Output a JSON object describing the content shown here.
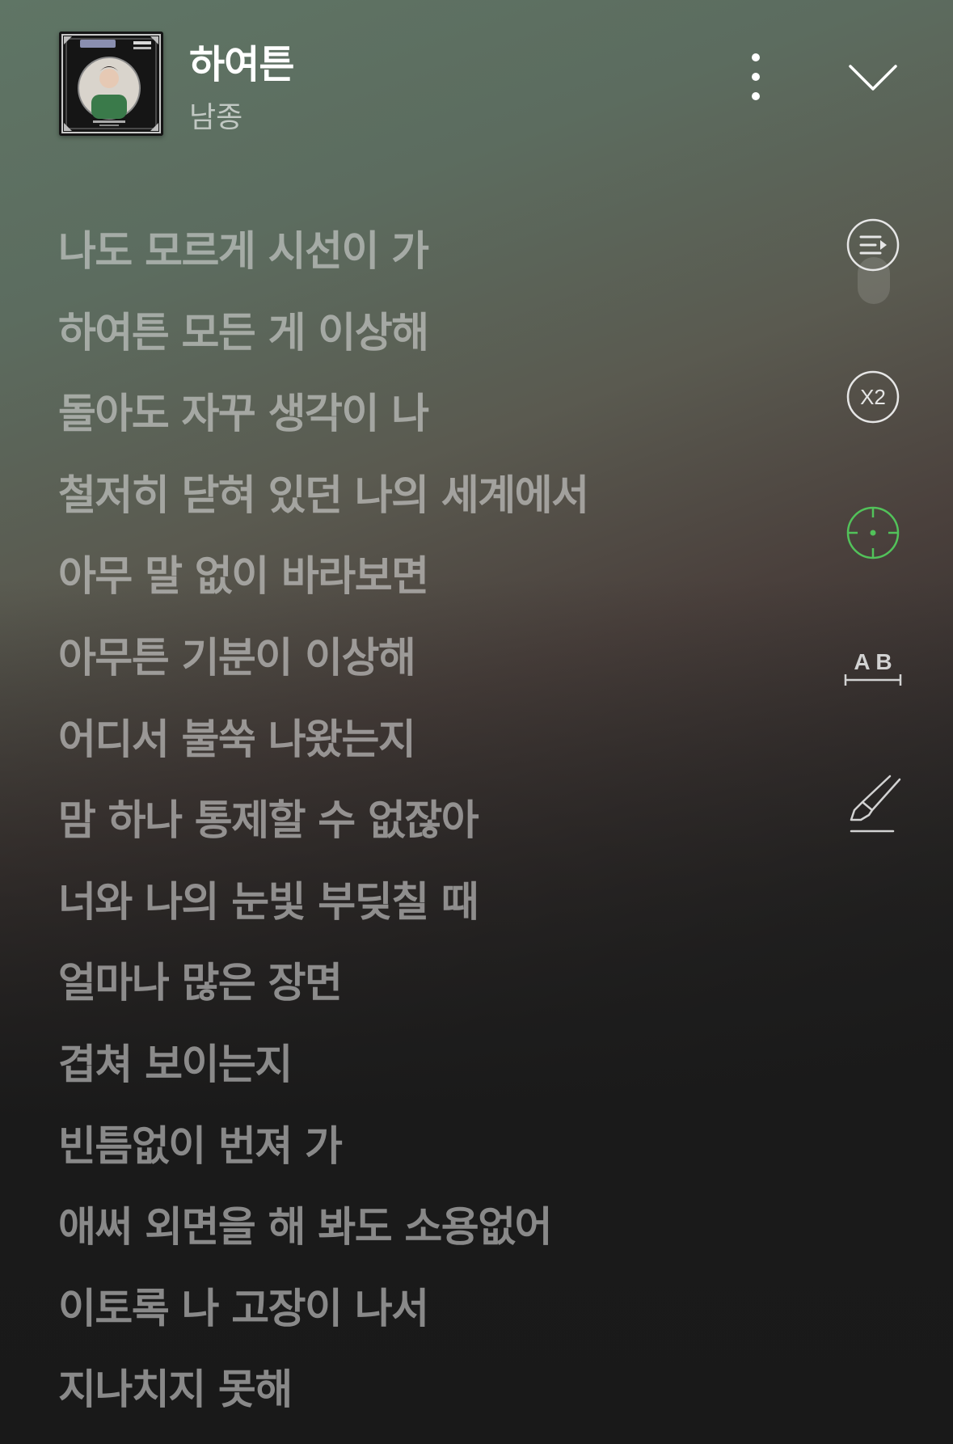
{
  "header": {
    "title": "하여튼",
    "artist": "남종",
    "album_art_icon": "album-cover",
    "more_icon": "more-vertical-icon",
    "collapse_icon": "chevron-down-icon"
  },
  "lyrics": [
    "나도 모르게 시선이 가",
    "하여튼 모든 게 이상해",
    "돌아도 자꾸 생각이 나",
    "철저히 닫혀 있던 나의 세계에서",
    "아무 말 없이 바라보면",
    "아무튼 기분이 이상해",
    "어디서 불쑥 나왔는지",
    "맘 하나 통제할 수 없잖아",
    "너와 나의 눈빛 부딪칠 때",
    "얼마나 많은 장면",
    "겹쳐 보이는지",
    "빈틈없이 번져 가",
    "애써 외면을 해 봐도 소용없어",
    "이토록 나 고장이 나서",
    "지나치지 못해"
  ],
  "tools": {
    "speed_label": "X2",
    "ab_label": "A B",
    "accent_color": "#52c25a",
    "icon_color": "#e0e0e0"
  }
}
